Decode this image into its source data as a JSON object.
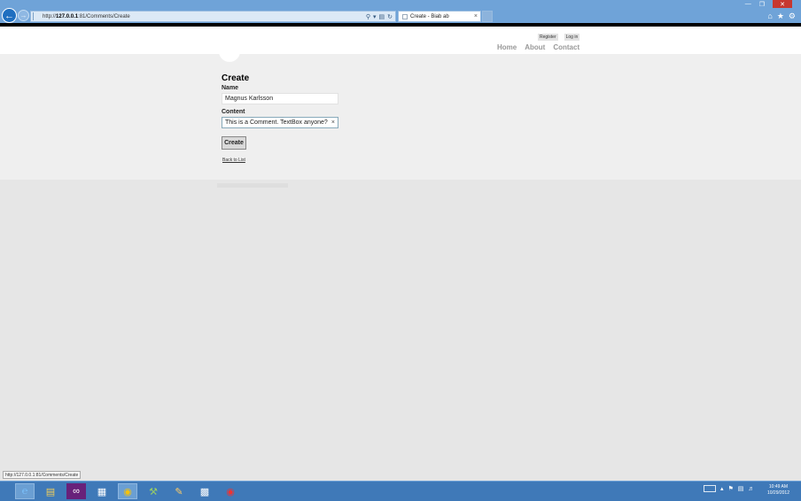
{
  "browser": {
    "url_prefix": "http://",
    "url_host": "127.0.0.1",
    "url_rest": ":81/Comments/Create",
    "tab_title": "Create - Biab ab",
    "tab_close": "×",
    "address_icons": [
      "search-icon",
      "dropdown-icon",
      "compat-icon",
      "refresh-icon"
    ],
    "window_controls": [
      "minimize",
      "restore",
      "close"
    ],
    "tool_icons": [
      "home-icon",
      "favorites-star-icon",
      "settings-gear-icon"
    ]
  },
  "site": {
    "login_links": {
      "register": "Register",
      "login": "Log in"
    },
    "nav": {
      "home": "Home",
      "about": "About",
      "contact": "Contact"
    }
  },
  "form": {
    "title": "Create",
    "name_label": "Name",
    "name_value": "Magnus Karlsson",
    "content_label": "Content",
    "content_value": "This is a Comment. TextBox anyone?",
    "clear_symbol": "×",
    "create_button": "Create",
    "back_link": "Back to List"
  },
  "status_tooltip": "http://127.0.0.1:81/Comments/Create",
  "taskbar": {
    "apps": [
      "internet-explorer",
      "file-explorer",
      "visual-studio",
      "app-4",
      "chrome",
      "app-6",
      "app-7",
      "app-8",
      "app-9"
    ],
    "clock_time": "10:49 AM",
    "clock_date": "10/29/2012"
  },
  "colors": {
    "chrome_blue": "#6fa3d8",
    "taskbar_blue": "#3f79b8",
    "content_bg": "#efefef",
    "page_bg": "#e6e6e6"
  }
}
